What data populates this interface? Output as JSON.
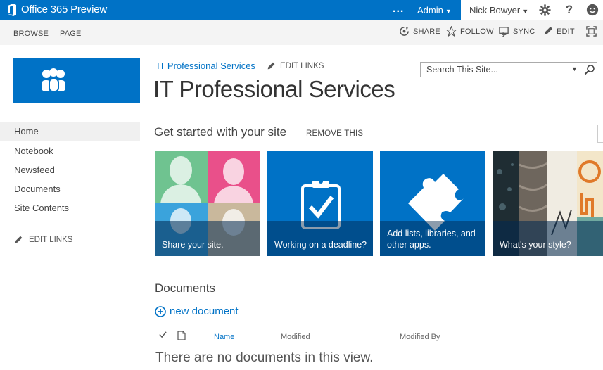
{
  "suite_bar": {
    "title": "Office 365 Preview",
    "more_label": "...",
    "admin_label": "Admin",
    "user_name": "Nick Bowyer",
    "icons": [
      "office-logo-icon",
      "settings-gear-icon",
      "help-icon",
      "profile-smiley-icon"
    ]
  },
  "ribbon": {
    "tabs": [
      "BROWSE",
      "PAGE"
    ],
    "actions": {
      "share": "SHARE",
      "follow": "FOLLOW",
      "sync": "SYNC",
      "edit": "EDIT"
    }
  },
  "top_nav": {
    "link": "IT Professional Services",
    "edit_links": "EDIT LINKS"
  },
  "site": {
    "title": "IT Professional Services"
  },
  "search": {
    "placeholder": "Search This Site..."
  },
  "left_nav": {
    "items": [
      "Home",
      "Notebook",
      "Newsfeed",
      "Documents",
      "Site Contents"
    ],
    "selected": "Home",
    "edit_links": "EDIT LINKS"
  },
  "get_started": {
    "title": "Get started with your site",
    "remove": "REMOVE THIS",
    "tiles": [
      {
        "caption": "Share your site."
      },
      {
        "caption": "Working on a deadline?"
      },
      {
        "caption": "Add lists, libraries, and other apps."
      },
      {
        "caption": "What's your style?"
      }
    ]
  },
  "documents": {
    "title": "Documents",
    "new_document": "new document",
    "columns": [
      "Name",
      "Modified",
      "Modified By"
    ],
    "empty_message": "There are no documents in this view."
  },
  "colors": {
    "brand_blue": "#0072c6",
    "tile_blue": "#0072c6",
    "text": "#444444"
  }
}
